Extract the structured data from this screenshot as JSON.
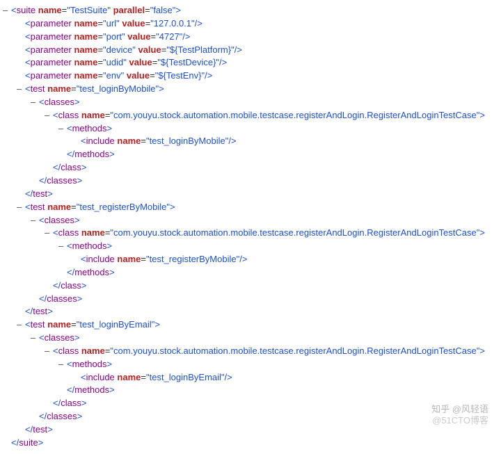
{
  "colors": {
    "tag": "#8b008b",
    "attr": "#b22222",
    "val": "#1a4fd6",
    "pun": "#1a4fd6"
  },
  "toggle": "–",
  "watermark1": "知乎 @风轻语",
  "watermark2": "@51CTO博客",
  "xml": {
    "suite": {
      "name": "TestSuite",
      "parallel": "false"
    },
    "parameters": [
      {
        "name": "url",
        "value": "127.0.0.1"
      },
      {
        "name": "port",
        "value": "4727"
      },
      {
        "name": "device",
        "value": "${TestPlatform}"
      },
      {
        "name": "udid",
        "value": "${TestDevice}"
      },
      {
        "name": "env",
        "value": "${TestEnv}"
      }
    ],
    "tests": [
      {
        "name": "test_loginByMobile",
        "className": "com.youyu.stock.automation.mobile.testcase.registerAndLogin.RegisterAndLoginTestCase",
        "include": "test_loginByMobile"
      },
      {
        "name": "test_registerByMobile",
        "className": "com.youyu.stock.automation.mobile.testcase.registerAndLogin.RegisterAndLoginTestCase",
        "include": "test_registerByMobile"
      },
      {
        "name": "test_loginByEmail",
        "className": "com.youyu.stock.automation.mobile.testcase.registerAndLogin.RegisterAndLoginTestCase",
        "include": "test_loginByEmail"
      }
    ],
    "tags": {
      "suite": "suite",
      "parameter": "parameter",
      "test": "test",
      "classes": "classes",
      "class": "class",
      "methods": "methods",
      "include": "include"
    },
    "attrs": {
      "name": "name",
      "value": "value",
      "parallel": "parallel"
    }
  }
}
